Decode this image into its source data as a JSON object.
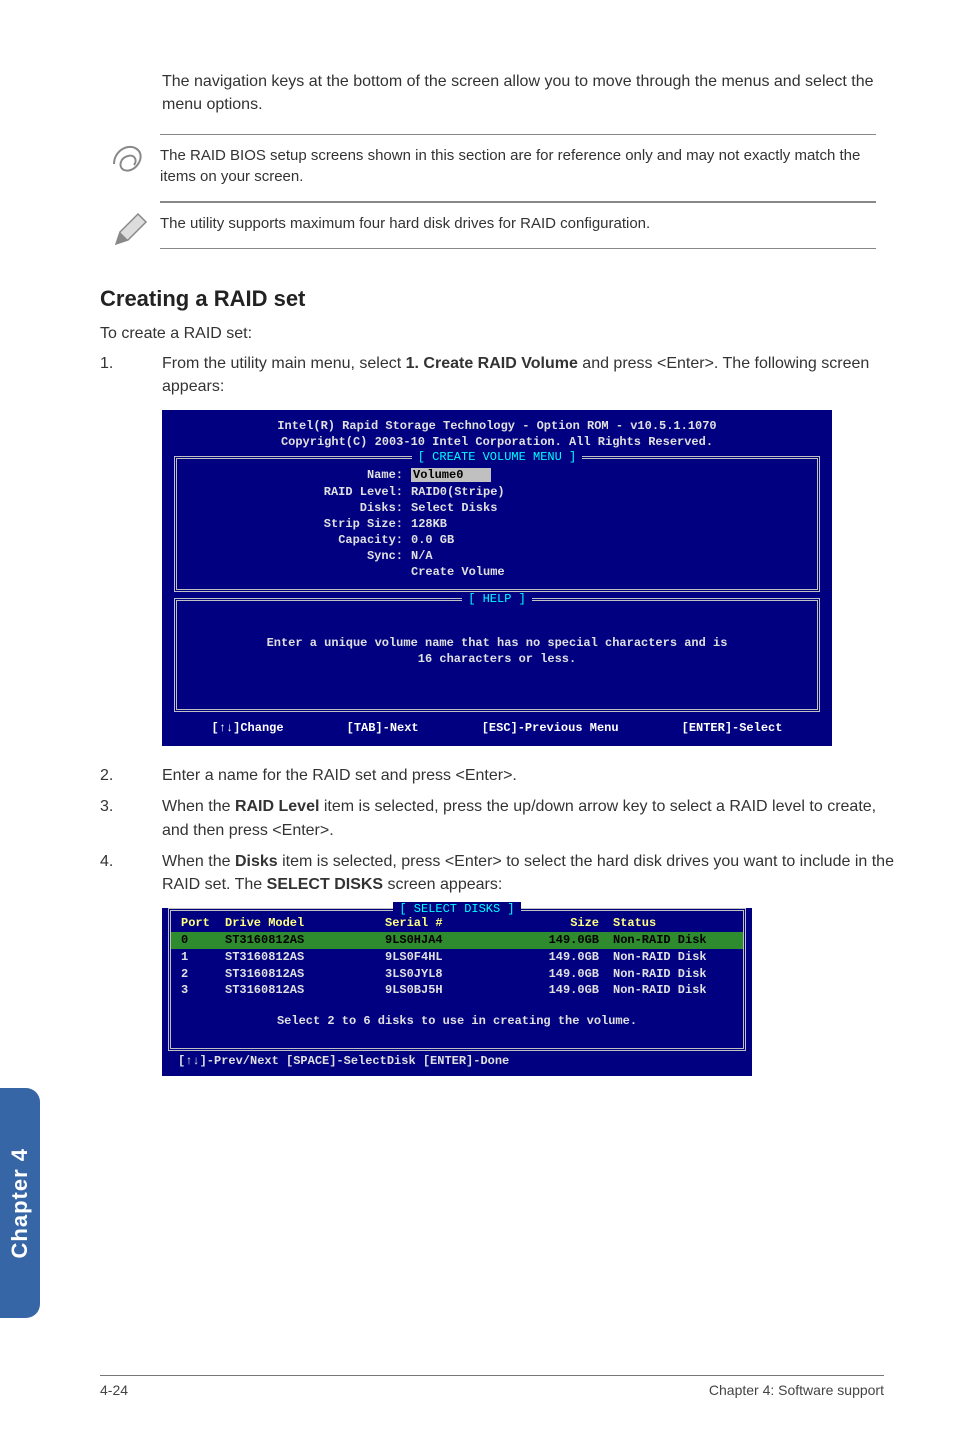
{
  "intro": "The navigation keys at the bottom of the screen allow you to move through the menus and select the menu options.",
  "notes": {
    "note1": "The RAID BIOS setup screens shown in this section are for reference only and may not exactly match the items on your screen.",
    "note2": "The utility supports maximum four hard disk drives for RAID configuration."
  },
  "h2": "Creating a RAID set",
  "lead": "To create a RAID set:",
  "steps": {
    "s1_pre": "From the utility main menu, select ",
    "s1_bold": "1. Create RAID Volume",
    "s1_post": " and press <Enter>. The following screen appears:",
    "s2": "Enter a name for the RAID set and press <Enter>.",
    "s3_pre": "When the ",
    "s3_bold": "RAID Level",
    "s3_post": " item is selected, press the up/down arrow key to select a RAID level to create, and then press <Enter>.",
    "s4_pre": "When the ",
    "s4_bold": "Disks",
    "s4_mid": " item is selected, press <Enter> to select the hard disk drives you want to include in the RAID set. The ",
    "s4_bold2": "SELECT DISKS",
    "s4_post": " screen appears:"
  },
  "nums": {
    "n1": "1.",
    "n2": "2.",
    "n3": "3.",
    "n4": "4."
  },
  "bios1": {
    "title1": "Intel(R) Rapid Storage Technology - Option ROM - v10.5.1.1070",
    "title2": "Copyright(C) 2003-10 Intel Corporation.  All Rights Reserved.",
    "frame1_label": "[ CREATE VOLUME MENU ]",
    "fields": {
      "name_l": "Name:",
      "name_v": "Volume0",
      "raid_l": "RAID Level:",
      "raid_v": "RAID0(Stripe)",
      "disks_l": "Disks:",
      "disks_v": "Select Disks",
      "strip_l": "Strip Size:",
      "strip_v": "128KB",
      "cap_l": "Capacity:",
      "cap_v": "0.0   GB",
      "sync_l": "Sync:",
      "sync_v": "N/A",
      "create": "Create Volume"
    },
    "frame2_label": "[ HELP ]",
    "help1": "Enter a unique volume name that has no special characters and is",
    "help2": "16 characters or less.",
    "foot": {
      "a": "[↑↓]Change",
      "b": "[TAB]-Next",
      "c": "[ESC]-Previous Menu",
      "d": "[ENTER]-Select"
    }
  },
  "bios2": {
    "label": "[ SELECT DISKS ]",
    "hdr": {
      "port": "Port",
      "model": "Drive Model",
      "serial": "Serial #",
      "size": "Size",
      "status": "Status"
    },
    "rows": [
      {
        "port": "0",
        "model": "ST3160812AS",
        "serial": "9LS0HJA4",
        "size": "149.0GB",
        "status": "Non-RAID Disk"
      },
      {
        "port": "1",
        "model": "ST3160812AS",
        "serial": "9LS0F4HL",
        "size": "149.0GB",
        "status": "Non-RAID Disk"
      },
      {
        "port": "2",
        "model": "ST3160812AS",
        "serial": "3LS0JYL8",
        "size": "149.0GB",
        "status": "Non-RAID Disk"
      },
      {
        "port": "3",
        "model": "ST3160812AS",
        "serial": "9LS0BJ5H",
        "size": "149.0GB",
        "status": "Non-RAID Disk"
      }
    ],
    "help": "Select 2 to 6 disks to use in creating the volume.",
    "foot": "[↑↓]-Prev/Next [SPACE]-SelectDisk [ENTER]-Done"
  },
  "sidebar": "Chapter 4",
  "footer": {
    "left": "4-24",
    "right": "Chapter 4: Software support"
  }
}
